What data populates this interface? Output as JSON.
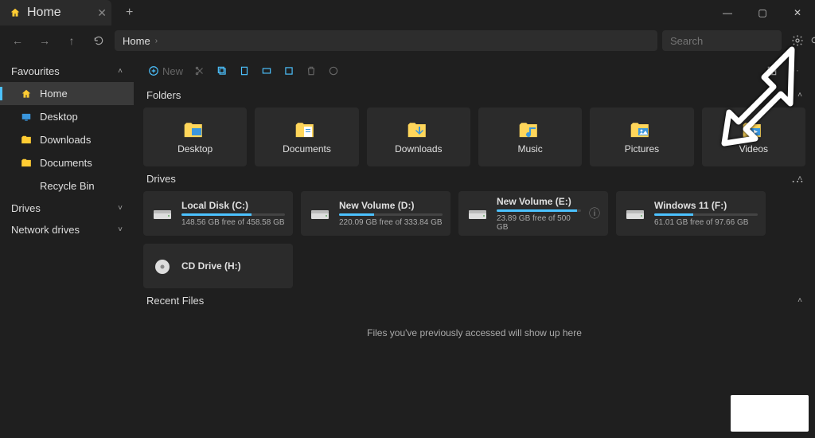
{
  "titlebar": {
    "tab_label": "Home"
  },
  "nav": {
    "breadcrumb": "Home",
    "search_placeholder": "Search"
  },
  "toolbar": {
    "new_label": "New"
  },
  "sidebar": {
    "favourites_label": "Favourites",
    "drives_label": "Drives",
    "network_label": "Network drives",
    "items": [
      {
        "label": "Home"
      },
      {
        "label": "Desktop"
      },
      {
        "label": "Downloads"
      },
      {
        "label": "Documents"
      },
      {
        "label": "Recycle Bin"
      }
    ]
  },
  "sections": {
    "folders_label": "Folders",
    "drives_label": "Drives",
    "recent_label": "Recent Files",
    "recent_empty": "Files you've previously accessed will show up here"
  },
  "folders": [
    {
      "label": "Desktop"
    },
    {
      "label": "Documents"
    },
    {
      "label": "Downloads"
    },
    {
      "label": "Music"
    },
    {
      "label": "Pictures"
    },
    {
      "label": "Videos"
    }
  ],
  "drives": [
    {
      "name": "Local Disk (C:)",
      "free": "148.56 GB free of 458.58 GB",
      "pct": 68
    },
    {
      "name": "New Volume (D:)",
      "free": "220.09 GB free of 333.84 GB",
      "pct": 34
    },
    {
      "name": "New Volume (E:)",
      "free": "23.89 GB free of 500 GB",
      "pct": 95,
      "info": true
    },
    {
      "name": "Windows 11 (F:)",
      "free": "61.01 GB free of 97.66 GB",
      "pct": 38
    },
    {
      "name": "CD Drive (H:)",
      "free": "",
      "pct": 0,
      "nobar": true,
      "cd": true
    }
  ]
}
